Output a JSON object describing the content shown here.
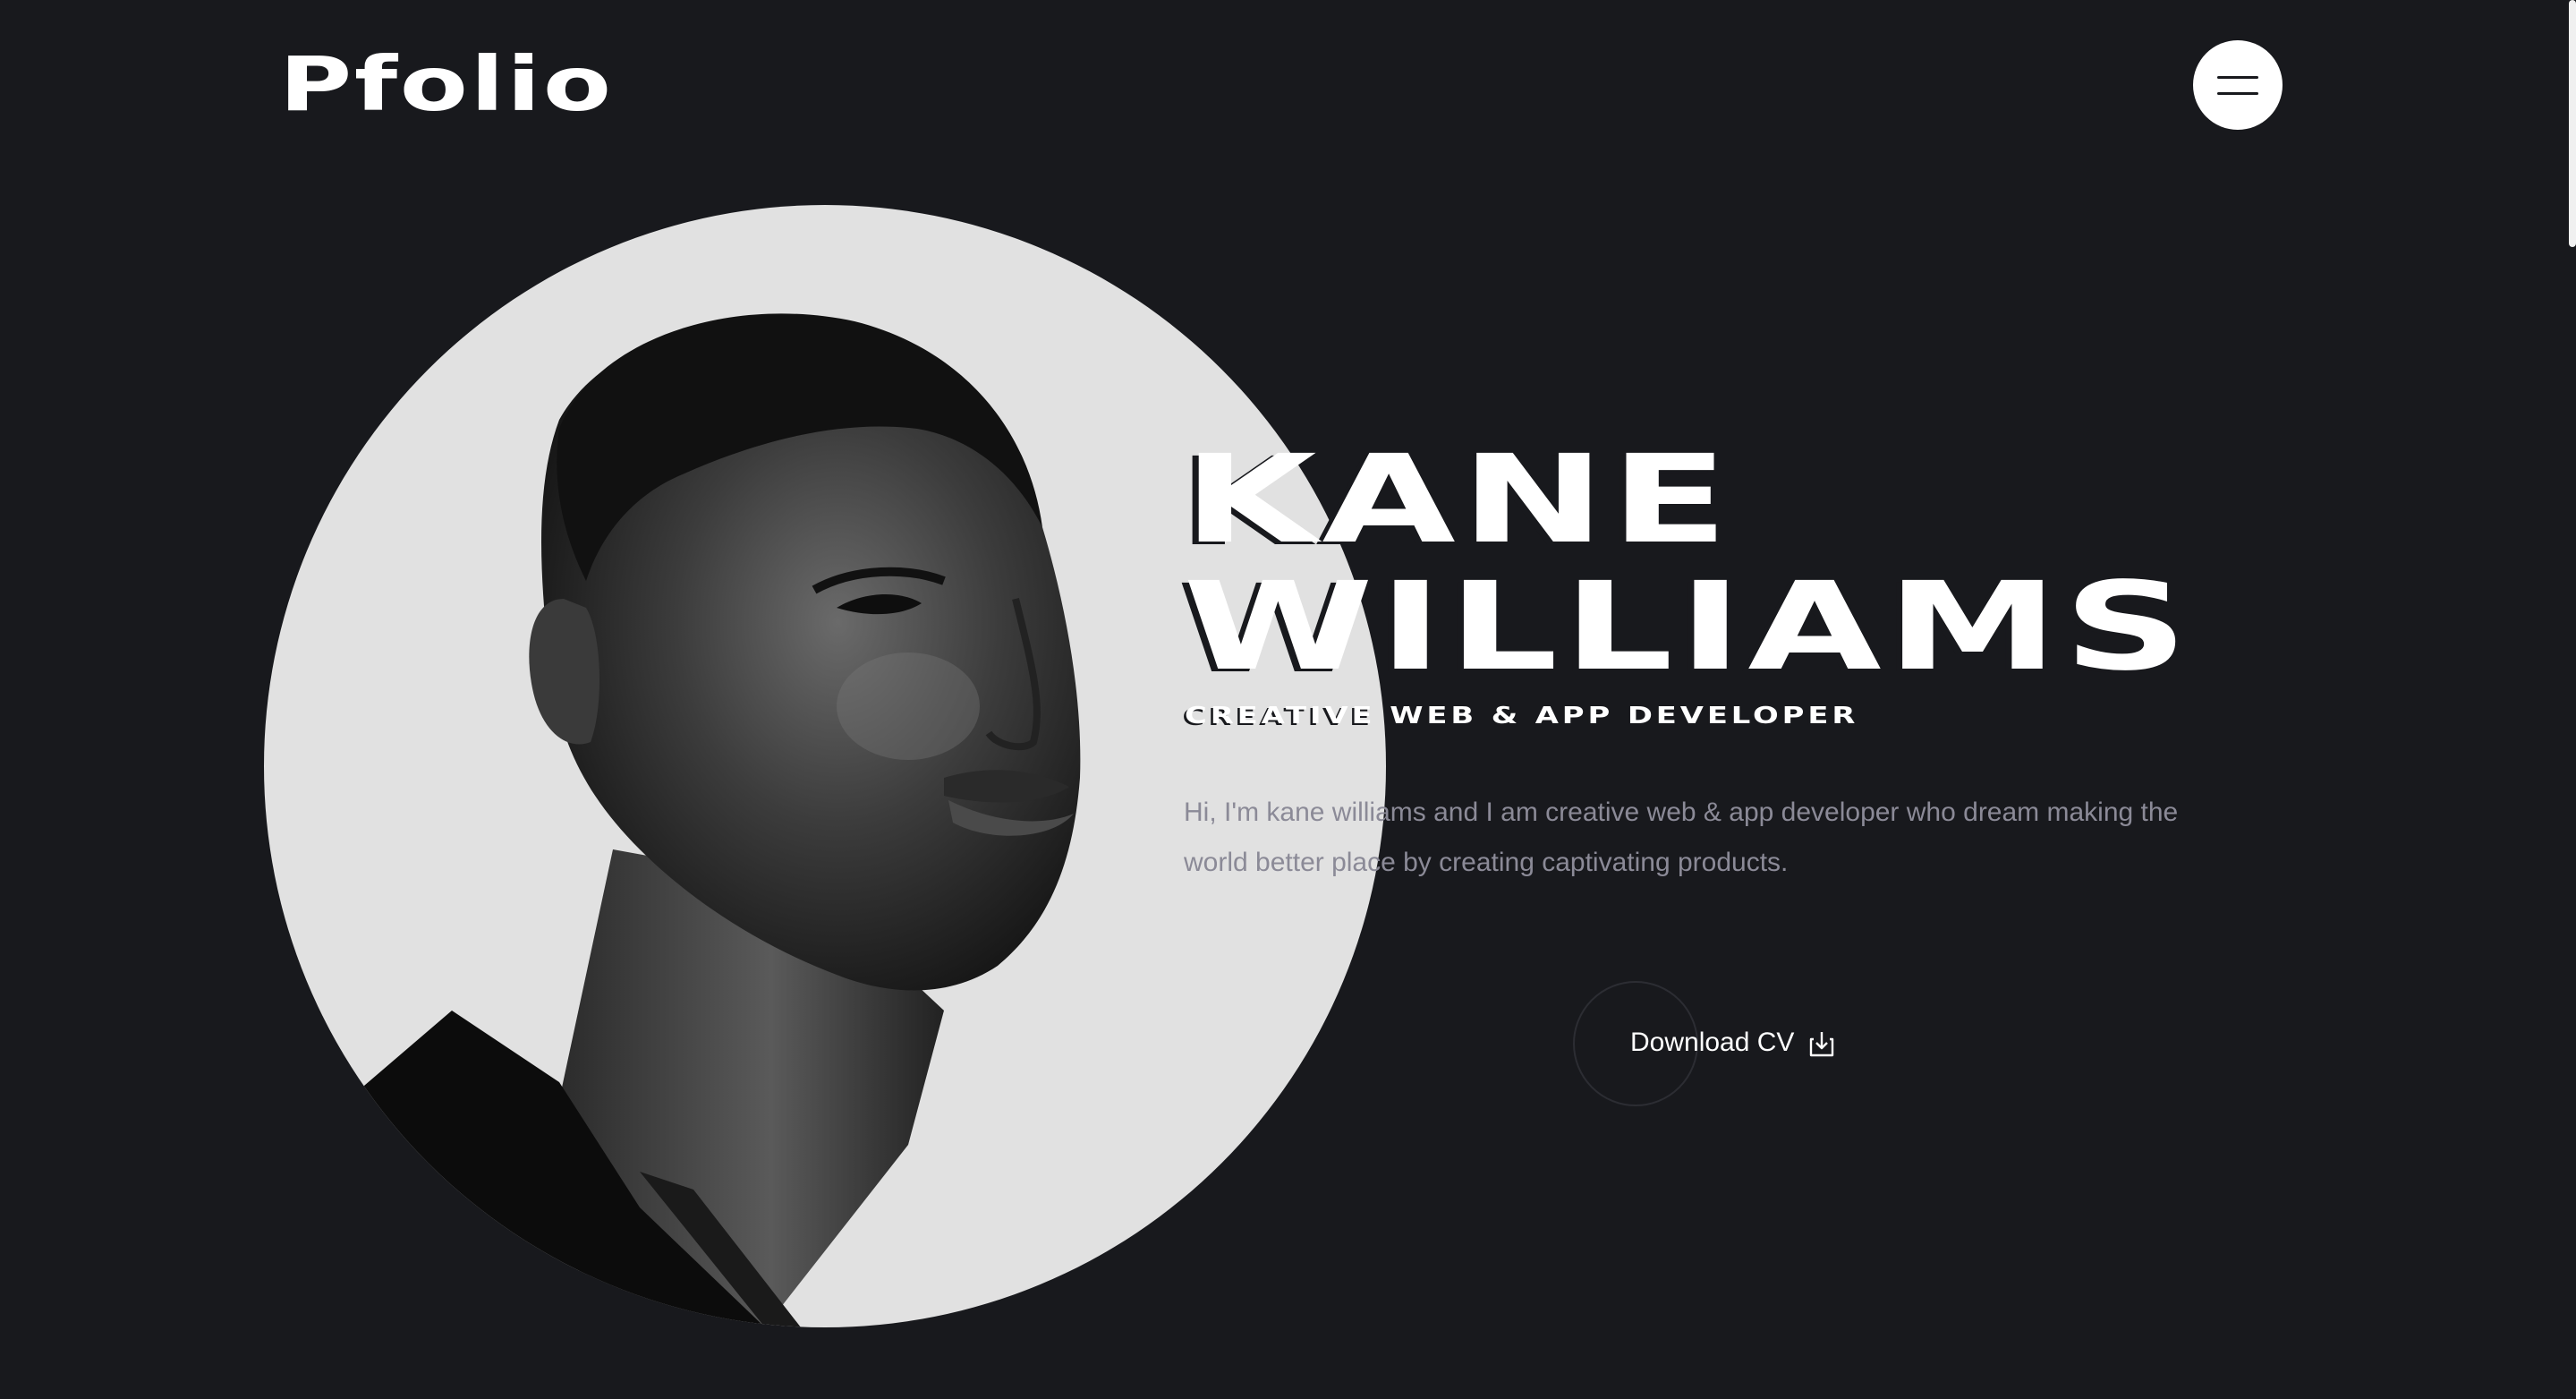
{
  "header": {
    "logo_text": "Pfolio",
    "menu_icon": "hamburger-menu-icon"
  },
  "hero": {
    "name_line1": "KANE",
    "name_line2": "WILLIAMS",
    "role": "CREATIVE WEB & APP DEVELOPER",
    "intro": "Hi, I'm kane williams and I am creative web & app developer who dream making the world better place by creating captivating products.",
    "cta_label": "Download CV",
    "cta_icon": "download-icon"
  },
  "colors": {
    "background": "#18191d",
    "circle": "#e1e1e1",
    "text_primary": "#ffffff",
    "text_muted": "#8b8a97"
  }
}
